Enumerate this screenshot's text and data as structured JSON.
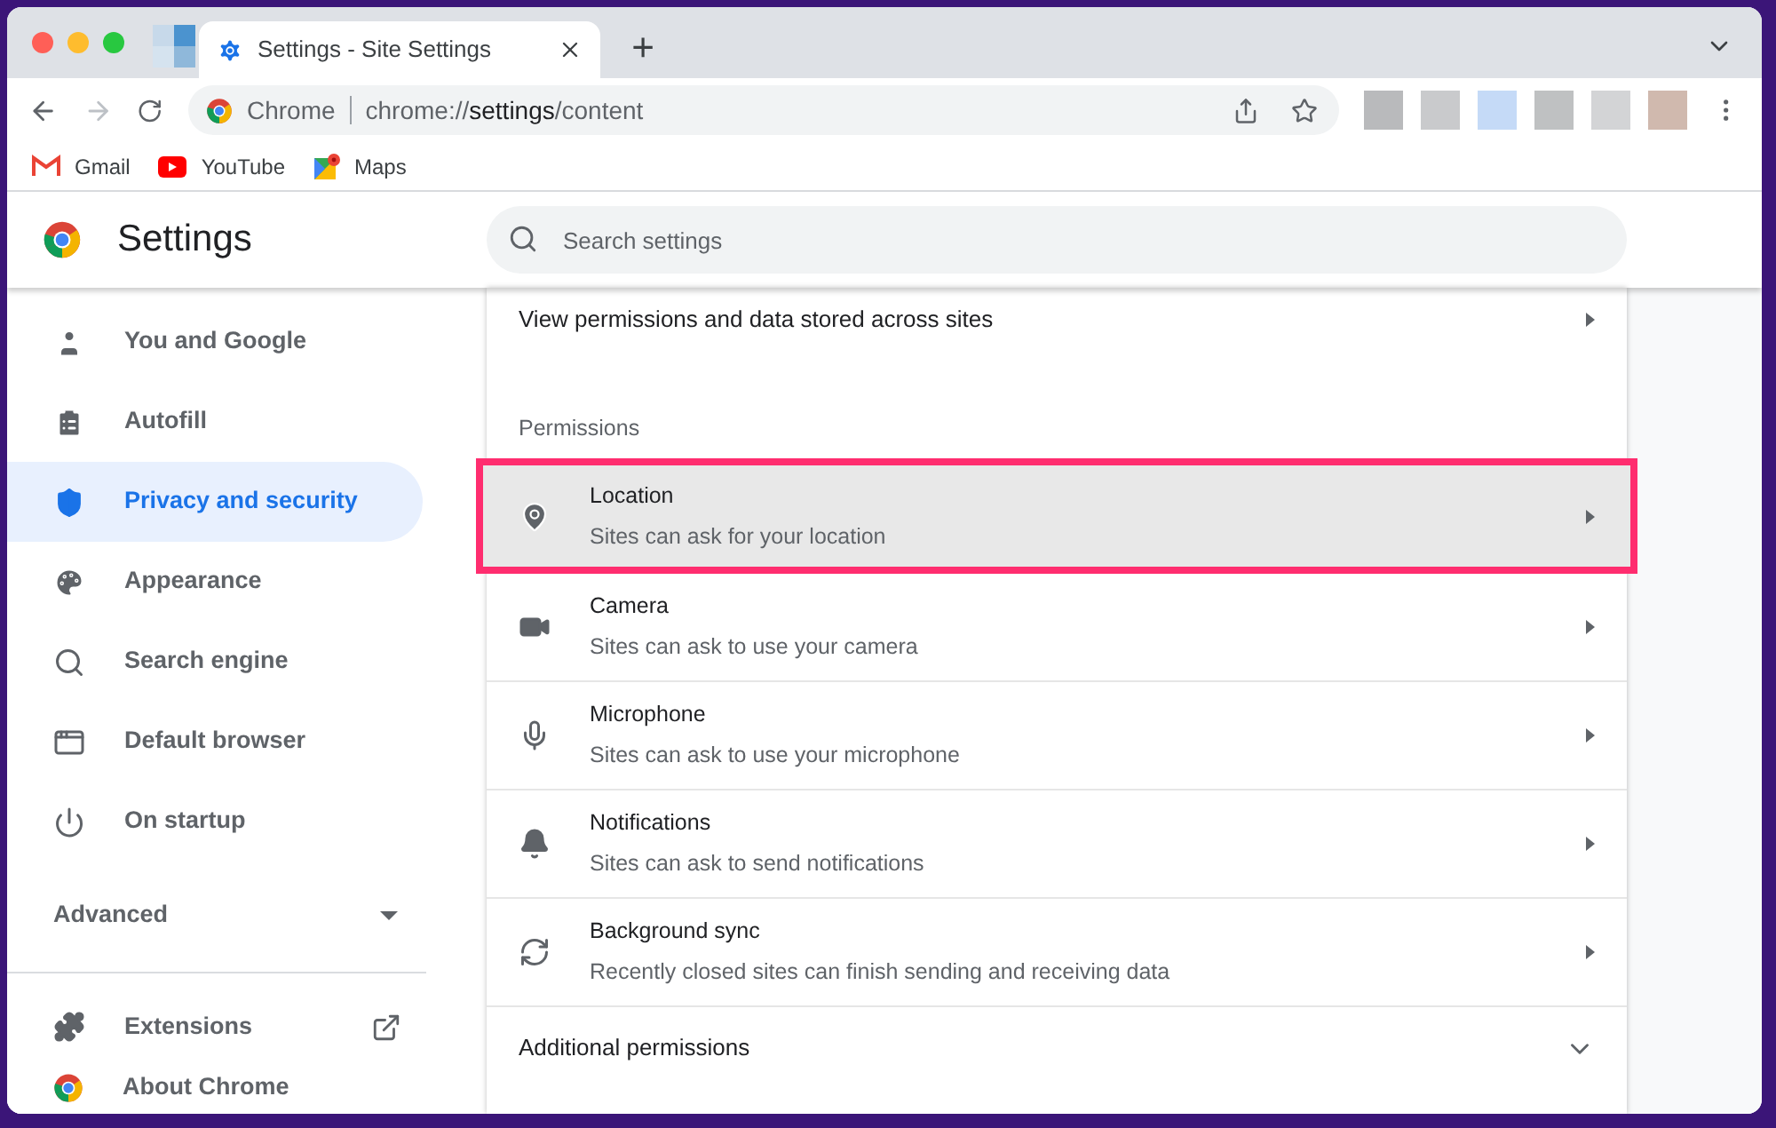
{
  "tab": {
    "title": "Settings - Site Settings",
    "selected": true
  },
  "new_tab": "+",
  "address_bar": {
    "site_label": "Chrome",
    "url_prefix": "chrome://",
    "url_host": "settings",
    "url_path": "/content"
  },
  "bookmarks": [
    {
      "kind": "gmail",
      "label": "Gmail"
    },
    {
      "kind": "youtube",
      "label": "YouTube"
    },
    {
      "kind": "maps",
      "label": "Maps"
    }
  ],
  "header": {
    "title": "Settings",
    "search_placeholder": "Search settings"
  },
  "sidebar": {
    "items": [
      {
        "kind": "person",
        "label": "You and Google",
        "selected": false
      },
      {
        "kind": "clipboard",
        "label": "Autofill",
        "selected": false
      },
      {
        "kind": "shield",
        "label": "Privacy and security",
        "selected": true
      },
      {
        "kind": "palette",
        "label": "Appearance",
        "selected": false
      },
      {
        "kind": "search",
        "label": "Search engine",
        "selected": false
      },
      {
        "kind": "browser",
        "label": "Default browser",
        "selected": false
      },
      {
        "kind": "power",
        "label": "On startup",
        "selected": false
      }
    ],
    "advanced": {
      "label": "Advanced",
      "expanded": false
    },
    "extensions": "Extensions",
    "about": "About Chrome"
  },
  "content": {
    "view_all": "View permissions and data stored across sites",
    "section_title": "Permissions",
    "permissions": [
      {
        "kind": "pin",
        "title": "Location",
        "subtitle": "Sites can ask for your location",
        "selected": true
      },
      {
        "kind": "camera",
        "title": "Camera",
        "subtitle": "Sites can ask to use your camera",
        "selected": false
      },
      {
        "kind": "mic",
        "title": "Microphone",
        "subtitle": "Sites can ask to use your microphone",
        "selected": false
      },
      {
        "kind": "bell",
        "title": "Notifications",
        "subtitle": "Sites can ask to send notifications",
        "selected": false
      },
      {
        "kind": "sync",
        "title": "Background sync",
        "subtitle": "Recently closed sites can finish sending and receiving data",
        "selected": false
      }
    ],
    "additional": {
      "label": "Additional permissions",
      "expanded": false
    }
  }
}
